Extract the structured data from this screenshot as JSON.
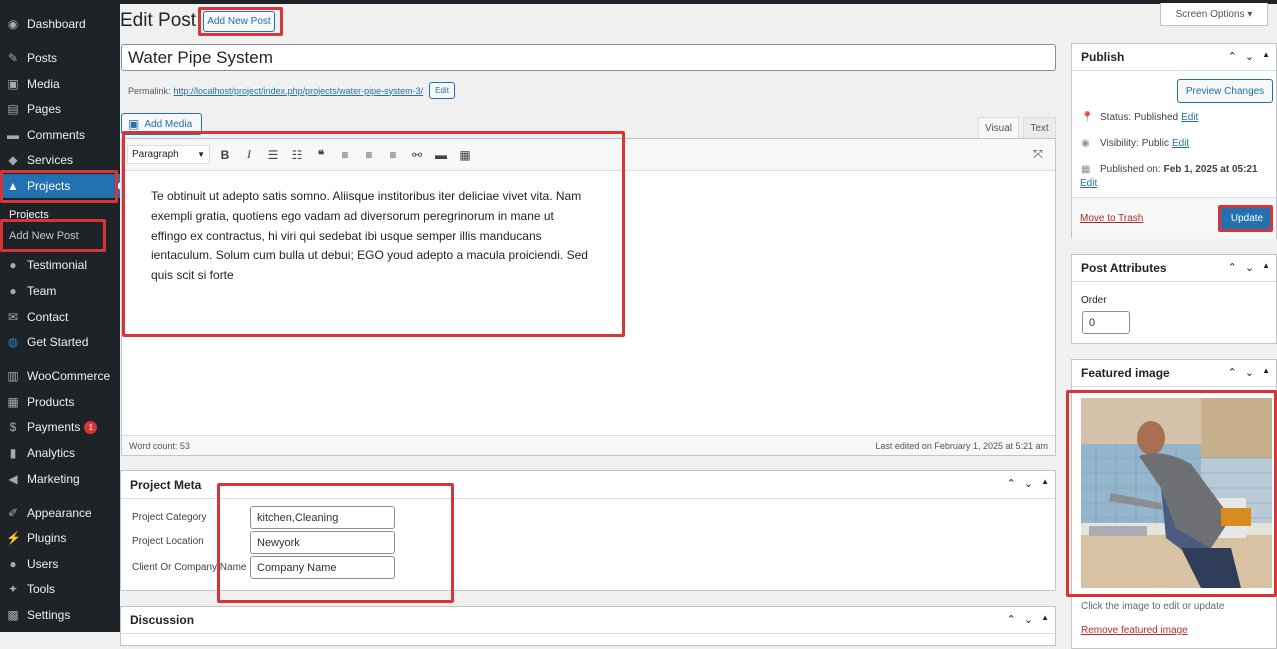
{
  "sidebar": {
    "items": [
      {
        "label": "Dashboard",
        "icon": "dashboard-icon",
        "glyph": "◉"
      },
      {
        "label": "Posts",
        "icon": "pin-icon",
        "glyph": "✎"
      },
      {
        "label": "Media",
        "icon": "media-icon",
        "glyph": "▣"
      },
      {
        "label": "Pages",
        "icon": "pages-icon",
        "glyph": "▤"
      },
      {
        "label": "Comments",
        "icon": "comments-icon",
        "glyph": "▬"
      },
      {
        "label": "Services",
        "icon": "tag-icon",
        "glyph": "◆"
      },
      {
        "label": "Projects",
        "icon": "projects-icon",
        "glyph": "▲"
      },
      {
        "label": "Testimonial",
        "icon": "person-icon",
        "glyph": "●"
      },
      {
        "label": "Team",
        "icon": "person-icon",
        "glyph": "●"
      },
      {
        "label": "Contact",
        "icon": "mail-icon",
        "glyph": "✉"
      },
      {
        "label": "Get Started",
        "icon": "globe-icon",
        "glyph": "◍"
      },
      {
        "label": "WooCommerce",
        "icon": "woo-icon",
        "glyph": "▥"
      },
      {
        "label": "Products",
        "icon": "archive-icon",
        "glyph": "▦"
      },
      {
        "label": "Payments",
        "icon": "dollar-icon",
        "glyph": "$",
        "badge": "1"
      },
      {
        "label": "Analytics",
        "icon": "bars-icon",
        "glyph": "▮"
      },
      {
        "label": "Marketing",
        "icon": "megaphone-icon",
        "glyph": "◀"
      },
      {
        "label": "Appearance",
        "icon": "brush-icon",
        "glyph": "✐"
      },
      {
        "label": "Plugins",
        "icon": "plug-icon",
        "glyph": "⚡"
      },
      {
        "label": "Users",
        "icon": "users-icon",
        "glyph": "●"
      },
      {
        "label": "Tools",
        "icon": "wrench-icon",
        "glyph": "✦"
      },
      {
        "label": "Settings",
        "icon": "settings-icon",
        "glyph": "▩"
      }
    ],
    "sub": {
      "projects": "Projects",
      "add_new": "Add New Post"
    }
  },
  "header": {
    "title": "Edit Post",
    "add_new": "Add New Post",
    "screen_options": "Screen Options ▾"
  },
  "post": {
    "title": "Water Pipe System",
    "permalink_label": "Permalink:",
    "permalink_url": "http://localhost/project/index.php/projects/water-pipe-system-3/",
    "permalink_edit": "Edit"
  },
  "editor": {
    "add_media": "Add Media",
    "tab_visual": "Visual",
    "tab_text": "Text",
    "format": "Paragraph",
    "content": "Te obtinuit ut adepto satis somno. Aliisque institoribus iter deliciae vivet vita. Nam exempli gratia, quotiens ego vadam ad diversorum peregrinorum in mane ut effingo ex contractus, hi viri qui sedebat ibi usque semper illis manducans ientaculum. Solum cum bulla ut debui; EGO youd adepto a macula proiciendi. Sed quis scit si forte",
    "word_count": "Word count: 53",
    "last_edited": "Last edited on February 1, 2025 at 5:21 am"
  },
  "project_meta": {
    "title": "Project Meta",
    "fields": [
      {
        "label": "Project Category",
        "value": "kitchen,Cleaning"
      },
      {
        "label": "Project Location",
        "value": "Newyork"
      },
      {
        "label": "Client Or Company Name",
        "value": "Company Name"
      }
    ]
  },
  "discussion": {
    "title": "Discussion"
  },
  "publish": {
    "title": "Publish",
    "preview": "Preview Changes",
    "status_label": "Status:",
    "status_value": "Published",
    "visibility_label": "Visibility:",
    "visibility_value": "Public",
    "published_label": "Published on:",
    "published_value": "Feb 1, 2025 at 05:21",
    "edit": "Edit",
    "trash": "Move to Trash",
    "update": "Update"
  },
  "attributes": {
    "title": "Post Attributes",
    "order_label": "Order",
    "order_value": "0"
  },
  "featured": {
    "title": "Featured image",
    "hint": "Click the image to edit or update",
    "remove": "Remove featured image"
  },
  "colors": {
    "accent": "#2271b1",
    "sidebar": "#1d2327",
    "highlight": "#d63638"
  }
}
